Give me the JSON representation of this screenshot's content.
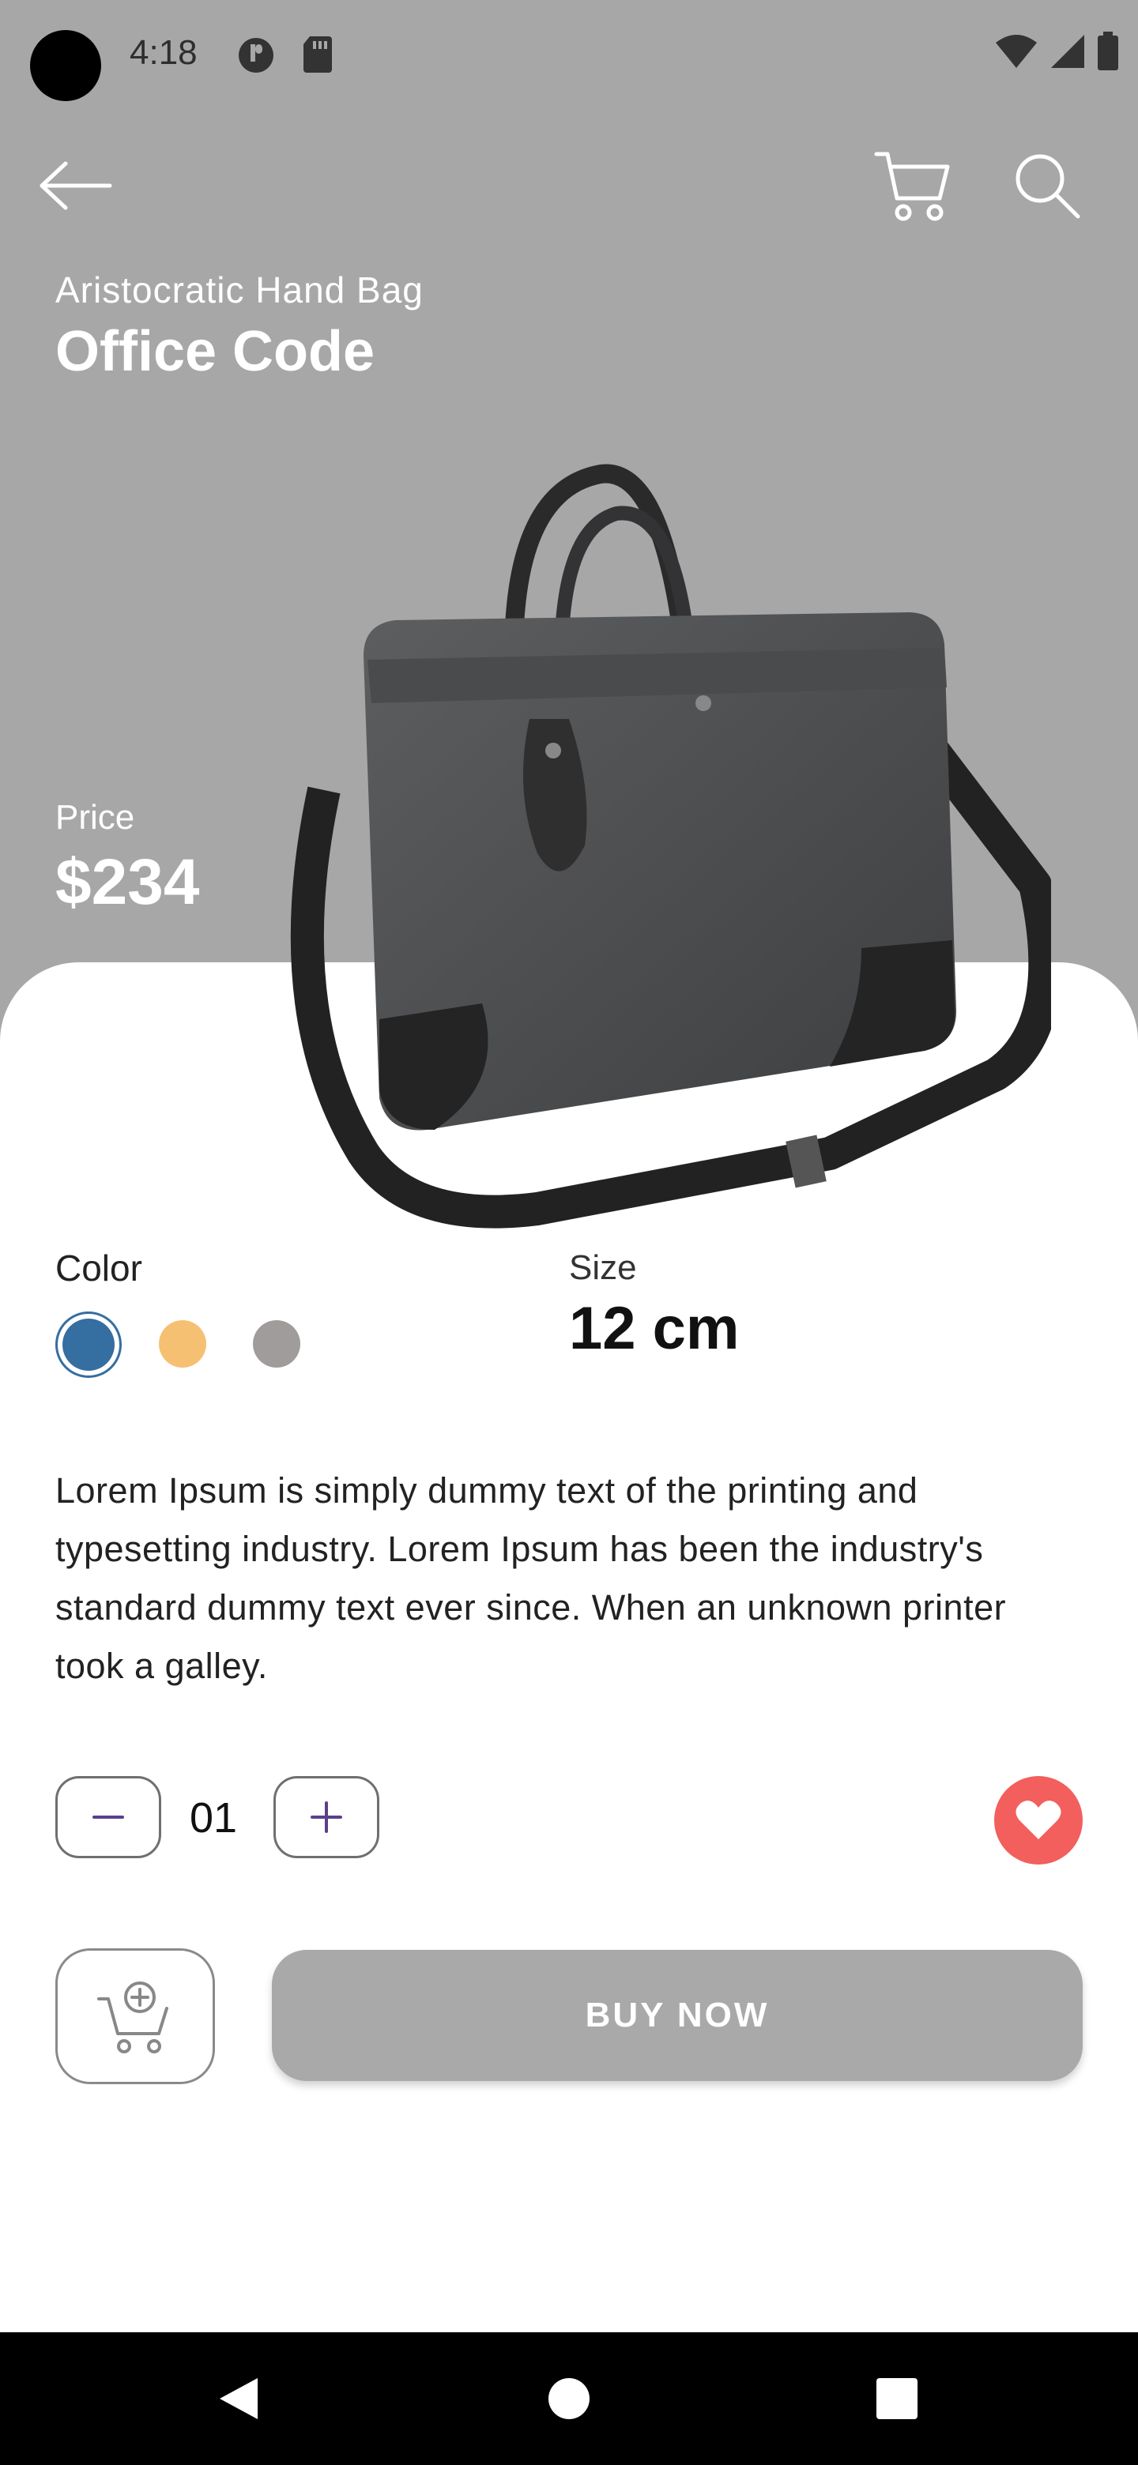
{
  "status_bar": {
    "time": "4:18"
  },
  "product": {
    "subtitle": "Aristocratic Hand Bag",
    "title": "Office Code",
    "price_label": "Price",
    "price": "$234",
    "color_label": "Color",
    "colors": [
      {
        "name": "blue",
        "hex": "#356ea0",
        "selected": true
      },
      {
        "name": "orange",
        "hex": "#f6c073",
        "selected": false
      },
      {
        "name": "gray",
        "hex": "#a19c9c",
        "selected": false
      }
    ],
    "size_label": "Size",
    "size_value": "12 cm",
    "description": "Lorem Ipsum is simply dummy text of the printing and typesetting industry. Lorem Ipsum has been the industry's standard dummy text ever since. When an unknown printer took a galley."
  },
  "quantity": {
    "value": "01"
  },
  "actions": {
    "buy_label": "BUY  NOW"
  },
  "icons": {
    "back": "arrow-left-icon",
    "cart": "cart-icon",
    "search": "search-icon",
    "minus": "minus-icon",
    "plus": "plus-icon",
    "favorite": "heart-icon",
    "add_to_cart": "cart-add-icon"
  },
  "theme": {
    "background": "#a7a7a7",
    "accent": "#f25f5c",
    "buy_button": "#a9a9a9"
  }
}
